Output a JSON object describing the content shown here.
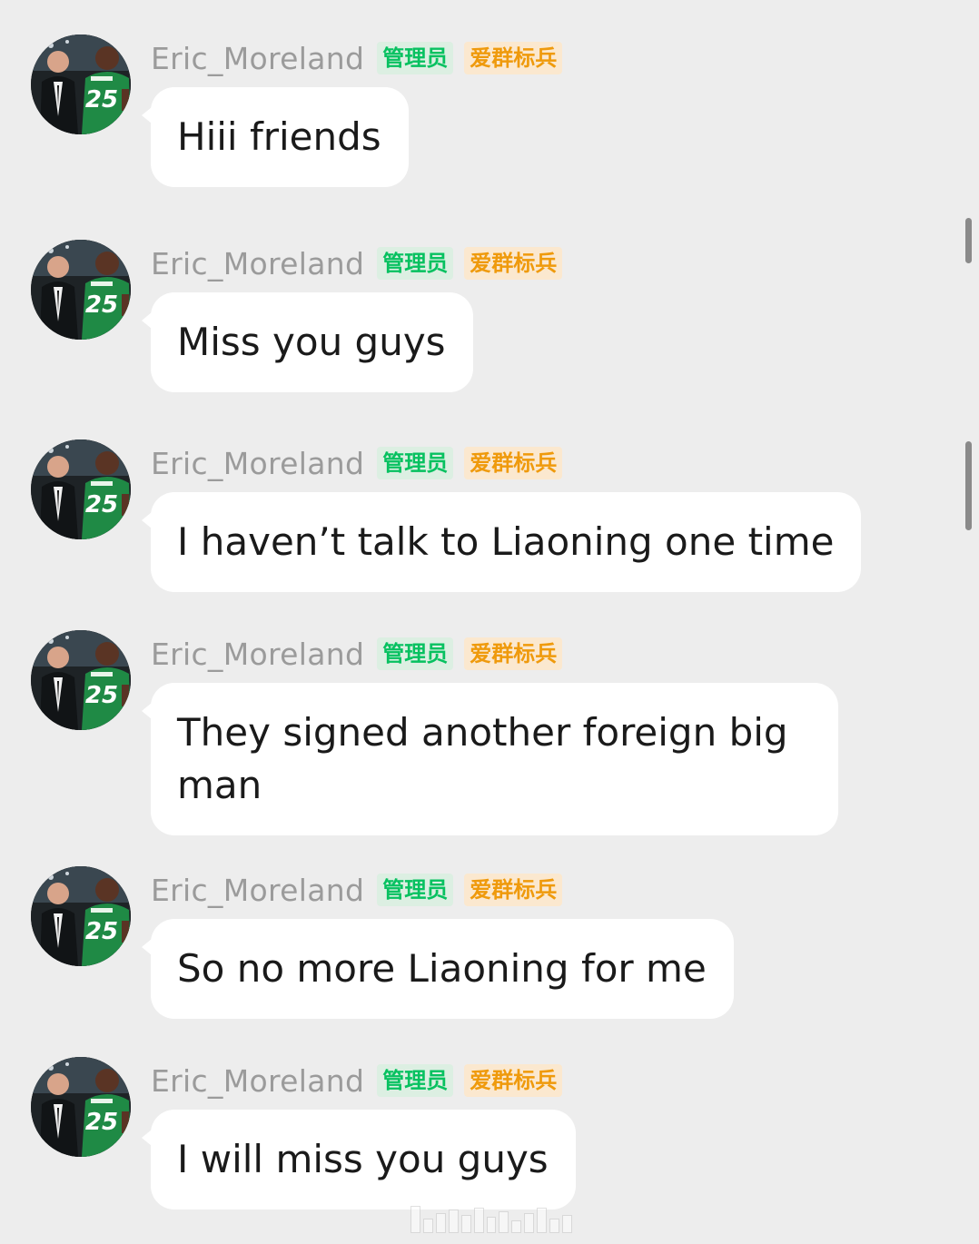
{
  "chat": {
    "messages": [
      {
        "username": "Eric_Moreland",
        "badge_admin": "管理员",
        "badge_title": "爱群标兵",
        "text": "Hiii friends"
      },
      {
        "username": "Eric_Moreland",
        "badge_admin": "管理员",
        "badge_title": "爱群标兵",
        "text": "Miss you guys"
      },
      {
        "username": "Eric_Moreland",
        "badge_admin": "管理员",
        "badge_title": "爱群标兵",
        "text": "I haven’t talk to Liaoning one time"
      },
      {
        "username": "Eric_Moreland",
        "badge_admin": "管理员",
        "badge_title": "爱群标兵",
        "text": "They signed another foreign big man"
      },
      {
        "username": "Eric_Moreland",
        "badge_admin": "管理员",
        "badge_title": "爱群标兵",
        "text": "So no more Liaoning for me"
      },
      {
        "username": "Eric_Moreland",
        "badge_admin": "管理员",
        "badge_title": "爱群标兵",
        "text": "I will miss you guys"
      }
    ]
  },
  "avatar": {
    "jersey_number": "25",
    "jersey_color": "#1f8a45",
    "icon": "user-avatar-basketball-icon"
  },
  "colors": {
    "background": "#ededed",
    "bubble": "#ffffff",
    "admin_badge_text": "#07c160",
    "title_badge_text": "#ef9a0c"
  }
}
